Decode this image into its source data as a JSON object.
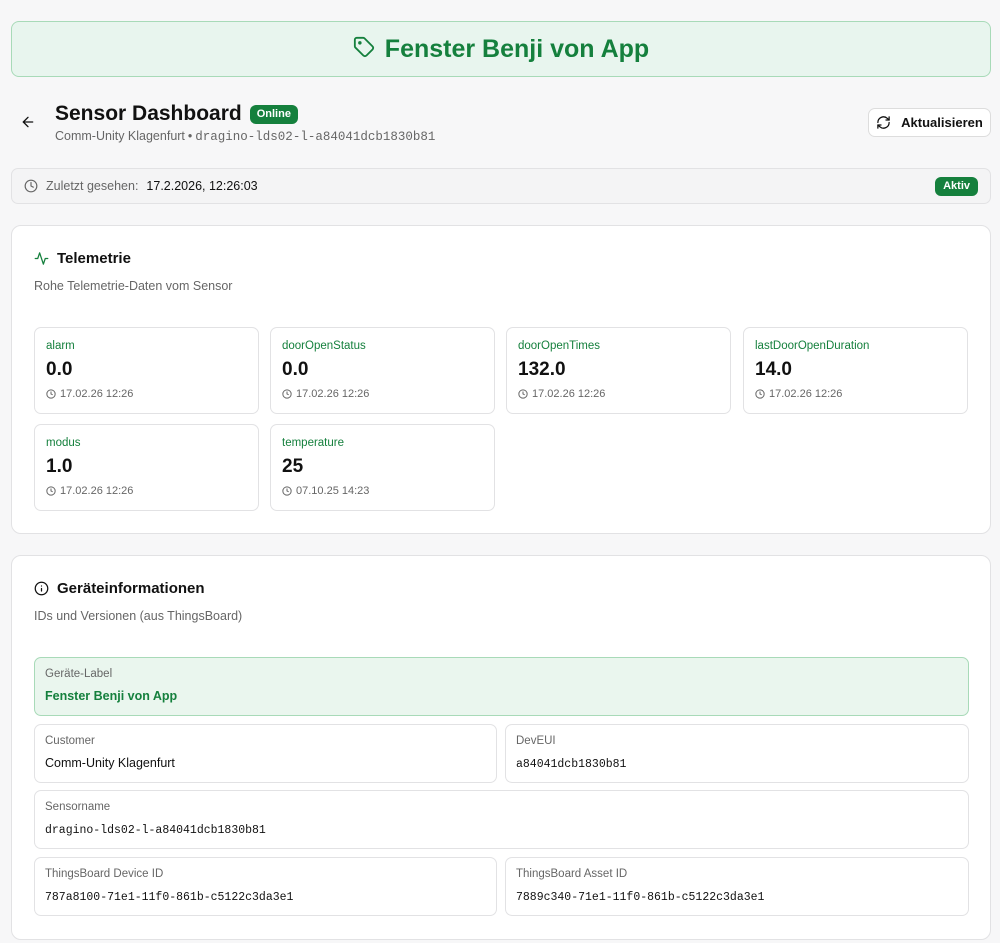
{
  "banner": {
    "title": "Fenster Benji von App"
  },
  "header": {
    "title": "Sensor Dashboard",
    "status_badge": "Online",
    "customer": "Comm-Unity Klagenfurt",
    "separator": "•",
    "sensor_name": "dragino-lds02-l-a84041dcb1830b81",
    "refresh_label": "Aktualisieren"
  },
  "last_seen": {
    "label": "Zuletzt gesehen:",
    "value": "17.2.2026, 12:26:03",
    "badge": "Aktiv"
  },
  "telemetry": {
    "title": "Telemetrie",
    "description": "Rohe Telemetrie-Daten vom Sensor",
    "items": [
      {
        "key": "alarm",
        "value": "0.0",
        "time": "17.02.26 12:26"
      },
      {
        "key": "doorOpenStatus",
        "value": "0.0",
        "time": "17.02.26 12:26"
      },
      {
        "key": "doorOpenTimes",
        "value": "132.0",
        "time": "17.02.26 12:26"
      },
      {
        "key": "lastDoorOpenDuration",
        "value": "14.0",
        "time": "17.02.26 12:26"
      },
      {
        "key": "modus",
        "value": "1.0",
        "time": "17.02.26 12:26"
      },
      {
        "key": "temperature",
        "value": "25",
        "time": "07.10.25 14:23"
      }
    ]
  },
  "device_info": {
    "title": "Geräteinformationen",
    "description": "IDs und Versionen (aus ThingsBoard)",
    "device_label": {
      "label": "Geräte-Label",
      "value": "Fenster Benji von App"
    },
    "customer": {
      "label": "Customer",
      "value": "Comm-Unity Klagenfurt"
    },
    "deveui": {
      "label": "DevEUI",
      "value": "a84041dcb1830b81"
    },
    "sensorname": {
      "label": "Sensorname",
      "value": "dragino-lds02-l-a84041dcb1830b81"
    },
    "device_id": {
      "label": "ThingsBoard Device ID",
      "value": "787a8100-71e1-11f0-861b-c5122c3da3e1"
    },
    "asset_id": {
      "label": "ThingsBoard Asset ID",
      "value": "7889c340-71e1-11f0-861b-c5122c3da3e1"
    }
  },
  "colors": {
    "accent": "#15803d",
    "banner_bg": "#e8f5ee"
  },
  "icons": {
    "banner": "tag-icon",
    "back": "arrow-left-icon",
    "refresh": "refresh-icon",
    "last_seen": "clock-icon",
    "telemetry": "activity-icon",
    "device_info": "info-icon"
  }
}
